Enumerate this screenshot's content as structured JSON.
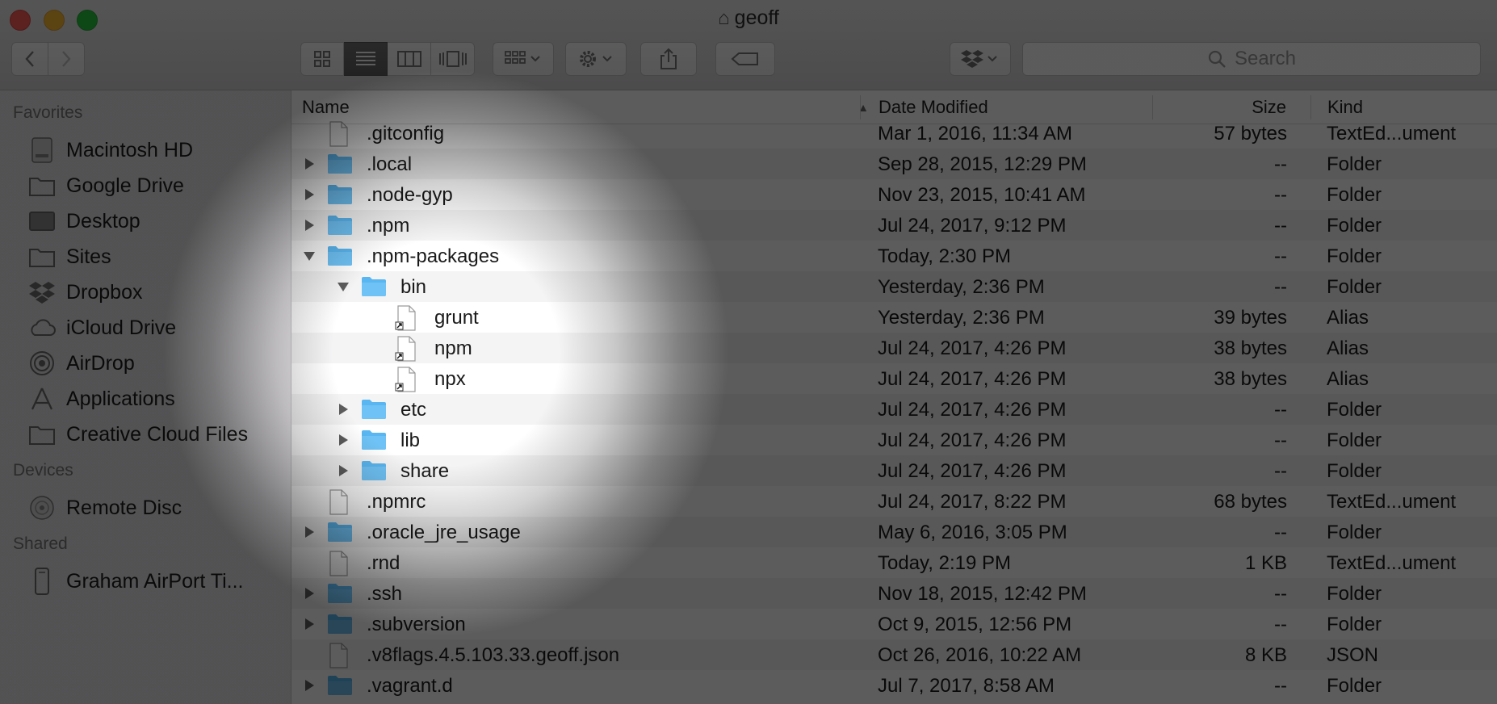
{
  "window": {
    "title": "geoff",
    "title_icon": "home-icon"
  },
  "toolbar": {
    "back_icon": "chevron-left-icon",
    "forward_icon": "chevron-right-icon",
    "view_modes": [
      "icon-view",
      "list-view",
      "column-view",
      "cover-flow-view"
    ],
    "active_view": "list-view",
    "group_icon": "arrange-icon",
    "action_icon": "gear-icon",
    "share_icon": "share-icon",
    "tags_icon": "tag-icon",
    "dropbox_icon": "dropbox-icon",
    "search_placeholder": "Search"
  },
  "sidebar": {
    "favorites_heading": "Favorites",
    "favorites": [
      {
        "label": "Macintosh HD",
        "icon": "hard-drive-icon"
      },
      {
        "label": "Google Drive",
        "icon": "folder-icon"
      },
      {
        "label": "Desktop",
        "icon": "desktop-icon"
      },
      {
        "label": "Sites",
        "icon": "folder-icon"
      },
      {
        "label": "Dropbox",
        "icon": "dropbox-icon"
      },
      {
        "label": "iCloud Drive",
        "icon": "cloud-icon"
      },
      {
        "label": "AirDrop",
        "icon": "airdrop-icon"
      },
      {
        "label": "Applications",
        "icon": "applications-icon"
      },
      {
        "label": "Creative Cloud Files",
        "icon": "folder-icon"
      }
    ],
    "devices_heading": "Devices",
    "devices": [
      {
        "label": "Remote Disc",
        "icon": "disc-icon"
      }
    ],
    "shared_heading": "Shared",
    "shared": [
      {
        "label": "Graham AirPort Ti...",
        "icon": "airport-icon"
      }
    ]
  },
  "columns": {
    "name": "Name",
    "date": "Date Modified",
    "size": "Size",
    "kind": "Kind",
    "sort_indicator": "▲"
  },
  "files": [
    {
      "name": ".gitconfig",
      "date": "Mar 1, 2016, 11:34 AM",
      "size": "57 bytes",
      "kind": "TextEd...ument",
      "type": "doc",
      "depth": 0,
      "disclosure": "none"
    },
    {
      "name": ".local",
      "date": "Sep 28, 2015, 12:29 PM",
      "size": "--",
      "kind": "Folder",
      "type": "folder",
      "depth": 0,
      "disclosure": "collapsed"
    },
    {
      "name": ".node-gyp",
      "date": "Nov 23, 2015, 10:41 AM",
      "size": "--",
      "kind": "Folder",
      "type": "folder",
      "depth": 0,
      "disclosure": "collapsed"
    },
    {
      "name": ".npm",
      "date": "Jul 24, 2017, 9:12 PM",
      "size": "--",
      "kind": "Folder",
      "type": "folder",
      "depth": 0,
      "disclosure": "collapsed"
    },
    {
      "name": ".npm-packages",
      "date": "Today, 2:30 PM",
      "size": "--",
      "kind": "Folder",
      "type": "folder",
      "depth": 0,
      "disclosure": "expanded"
    },
    {
      "name": "bin",
      "date": "Yesterday, 2:36 PM",
      "size": "--",
      "kind": "Folder",
      "type": "folder",
      "depth": 1,
      "disclosure": "expanded"
    },
    {
      "name": "grunt",
      "date": "Yesterday, 2:36 PM",
      "size": "39 bytes",
      "kind": "Alias",
      "type": "alias",
      "depth": 2,
      "disclosure": "none"
    },
    {
      "name": "npm",
      "date": "Jul 24, 2017, 4:26 PM",
      "size": "38 bytes",
      "kind": "Alias",
      "type": "alias",
      "depth": 2,
      "disclosure": "none"
    },
    {
      "name": "npx",
      "date": "Jul 24, 2017, 4:26 PM",
      "size": "38 bytes",
      "kind": "Alias",
      "type": "alias",
      "depth": 2,
      "disclosure": "none"
    },
    {
      "name": "etc",
      "date": "Jul 24, 2017, 4:26 PM",
      "size": "--",
      "kind": "Folder",
      "type": "folder",
      "depth": 1,
      "disclosure": "collapsed"
    },
    {
      "name": "lib",
      "date": "Jul 24, 2017, 4:26 PM",
      "size": "--",
      "kind": "Folder",
      "type": "folder",
      "depth": 1,
      "disclosure": "collapsed"
    },
    {
      "name": "share",
      "date": "Jul 24, 2017, 4:26 PM",
      "size": "--",
      "kind": "Folder",
      "type": "folder",
      "depth": 1,
      "disclosure": "collapsed"
    },
    {
      "name": ".npmrc",
      "date": "Jul 24, 2017, 8:22 PM",
      "size": "68 bytes",
      "kind": "TextEd...ument",
      "type": "doc",
      "depth": 0,
      "disclosure": "none"
    },
    {
      "name": ".oracle_jre_usage",
      "date": "May 6, 2016, 3:05 PM",
      "size": "--",
      "kind": "Folder",
      "type": "folder",
      "depth": 0,
      "disclosure": "collapsed"
    },
    {
      "name": ".rnd",
      "date": "Today, 2:19 PM",
      "size": "1 KB",
      "kind": "TextEd...ument",
      "type": "doc",
      "depth": 0,
      "disclosure": "none"
    },
    {
      "name": ".ssh",
      "date": "Nov 18, 2015, 12:42 PM",
      "size": "--",
      "kind": "Folder",
      "type": "folder",
      "depth": 0,
      "disclosure": "collapsed"
    },
    {
      "name": ".subversion",
      "date": "Oct 9, 2015, 12:56 PM",
      "size": "--",
      "kind": "Folder",
      "type": "folder",
      "depth": 0,
      "disclosure": "collapsed"
    },
    {
      "name": ".v8flags.4.5.103.33.geoff.json",
      "date": "Oct 26, 2016, 10:22 AM",
      "size": "8 KB",
      "kind": "JSON",
      "type": "doc",
      "depth": 0,
      "disclosure": "none"
    },
    {
      "name": ".vagrant.d",
      "date": "Jul 7, 2017, 8:58 AM",
      "size": "--",
      "kind": "Folder",
      "type": "folder",
      "depth": 0,
      "disclosure": "collapsed"
    }
  ],
  "colors": {
    "folder": "#5ab6f0",
    "sidebar_bg": "#e6e4e7",
    "row_alt": "#f4f4f5",
    "close": "#fc5f57",
    "minimize": "#fdbc2e",
    "zoom": "#28c840"
  }
}
